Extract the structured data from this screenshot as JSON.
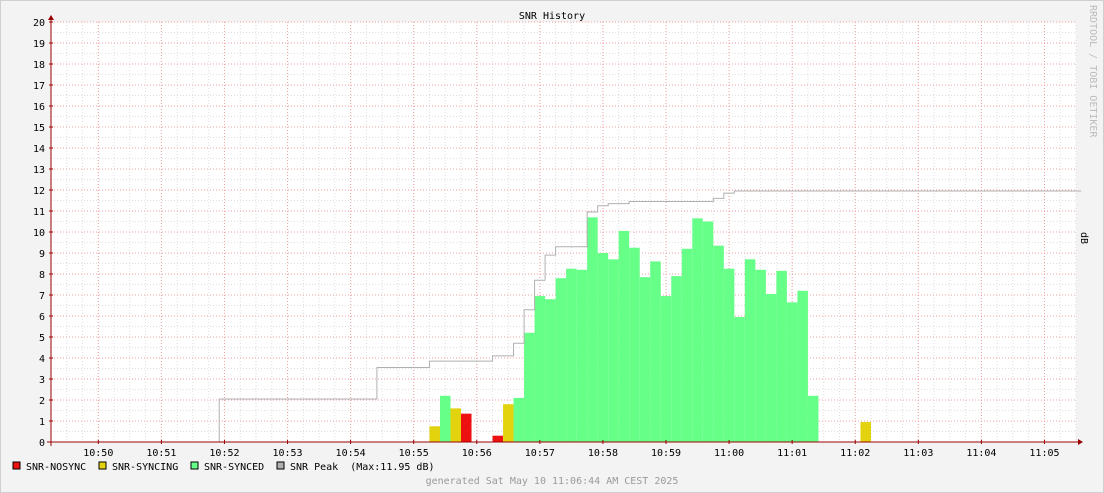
{
  "chart_data": {
    "type": "area",
    "title": "SNR History",
    "ylabel": "dB",
    "watermark": "RRDTOOL / TOBI OETIKER",
    "ylim": [
      0,
      20
    ],
    "y_ticks": [
      0,
      1,
      2,
      3,
      4,
      5,
      6,
      7,
      8,
      9,
      10,
      11,
      12,
      13,
      14,
      15,
      16,
      17,
      18,
      19,
      20
    ],
    "x_time_range": [
      "10:49:15",
      "11:05:30"
    ],
    "x_ticks": [
      "10:50",
      "10:51",
      "10:52",
      "10:53",
      "10:54",
      "10:55",
      "10:56",
      "10:57",
      "10:58",
      "10:59",
      "11:00",
      "11:01",
      "11:02",
      "11:03",
      "11:04",
      "11:05"
    ],
    "grid": true,
    "legend_position": "bottom-left",
    "colors": {
      "nosync": "#ee1111",
      "syncing": "#e3d20e",
      "synced": "#66ff88",
      "peak": "#b0b0b0",
      "grid_minor": "#dedede",
      "grid_major": "#f0a0a0",
      "axis": "#990000"
    },
    "interval_seconds": 10,
    "series": [
      {
        "name": "SNR-NOSYNC",
        "start": "10:49:15",
        "values": [
          0,
          0,
          0,
          0,
          0,
          0,
          0,
          0,
          0,
          0,
          0,
          0,
          0,
          0,
          0,
          0,
          0,
          0,
          0,
          0,
          0,
          0,
          0,
          0,
          0,
          0,
          0,
          0,
          0,
          0,
          0,
          0,
          0,
          0,
          0,
          0,
          0,
          0,
          0,
          1.35,
          0,
          0,
          0.3,
          0,
          0,
          0,
          0,
          0,
          0,
          0,
          0,
          0,
          0,
          0,
          0,
          0,
          0,
          0,
          0,
          0,
          0,
          0,
          0,
          0,
          0,
          0,
          0,
          0,
          0,
          0,
          0,
          0,
          0,
          0,
          0,
          0,
          0,
          0,
          0,
          0,
          0,
          0,
          0,
          0,
          0,
          0,
          0,
          0,
          0,
          0,
          0,
          0,
          0,
          0,
          0,
          0,
          0,
          0
        ]
      },
      {
        "name": "SNR-SYNCING",
        "start": "10:49:15",
        "values": [
          0,
          0,
          0,
          0,
          0,
          0,
          0,
          0,
          0,
          0,
          0,
          0,
          0,
          0,
          0,
          0,
          0,
          0,
          0,
          0,
          0,
          0,
          0,
          0,
          0,
          0,
          0,
          0,
          0,
          0,
          0,
          0,
          0,
          0,
          0,
          0,
          0.75,
          0,
          1.6,
          0,
          0,
          0,
          0,
          1.8,
          0,
          0,
          0,
          0,
          0,
          0,
          0,
          0,
          0,
          0,
          0,
          0,
          0,
          0,
          0,
          0,
          0,
          0,
          0,
          0,
          0,
          0,
          0,
          0,
          0,
          0,
          0,
          0,
          0,
          0,
          0,
          0,
          0,
          0.95,
          0,
          0,
          0,
          0,
          0,
          0,
          0,
          0,
          0,
          0,
          0,
          0,
          0,
          0,
          0,
          0,
          0,
          0,
          0,
          0,
          0,
          0
        ]
      },
      {
        "name": "SNR-SYNCED",
        "start": "10:49:15",
        "values": [
          0,
          0,
          0,
          0,
          0,
          0,
          0,
          0,
          0,
          0,
          0,
          0,
          0,
          0,
          0,
          0,
          0,
          0,
          0,
          0,
          0,
          0,
          0,
          0,
          0,
          0,
          0,
          0,
          0,
          0,
          0,
          0,
          0,
          0,
          0,
          0,
          0,
          2.2,
          0,
          0,
          0,
          0,
          0,
          0,
          2.1,
          5.2,
          6.95,
          6.8,
          7.8,
          8.25,
          8.2,
          10.7,
          9.0,
          8.7,
          10.05,
          9.25,
          7.85,
          8.6,
          6.95,
          7.9,
          9.2,
          10.65,
          10.5,
          9.35,
          8.25,
          5.95,
          8.7,
          8.2,
          7.05,
          8.15,
          6.65,
          7.2,
          2.2,
          0,
          0,
          0,
          0,
          0,
          0,
          0,
          0,
          0,
          0,
          0,
          0,
          0,
          0,
          0,
          0,
          0,
          0,
          0,
          0,
          0,
          0,
          0,
          0,
          0
        ]
      },
      {
        "name": "SNR Peak",
        "legend_suffix": "(Max:11.95 dB)",
        "type": "step",
        "start": "10:49:15",
        "values": [
          0,
          0,
          0,
          0,
          0,
          0,
          0,
          0,
          0,
          0,
          0,
          0,
          0,
          0,
          0,
          0,
          2.05,
          2.05,
          2.05,
          2.05,
          2.05,
          2.05,
          2.05,
          2.05,
          2.05,
          2.05,
          2.05,
          2.05,
          2.05,
          2.05,
          2.05,
          3.55,
          3.55,
          3.55,
          3.55,
          3.55,
          3.85,
          3.85,
          3.85,
          3.85,
          3.85,
          3.85,
          4.1,
          4.1,
          4.7,
          6.3,
          7.7,
          8.9,
          9.3,
          9.3,
          9.3,
          10.95,
          11.25,
          11.35,
          11.35,
          11.45,
          11.45,
          11.45,
          11.45,
          11.45,
          11.45,
          11.45,
          11.45,
          11.6,
          11.85,
          11.95,
          11.95,
          11.95,
          11.95,
          11.95,
          11.95,
          11.95,
          11.95,
          11.95,
          11.95,
          11.95,
          11.95,
          11.95,
          11.95,
          11.95,
          11.95,
          11.95,
          11.95,
          11.95,
          11.95,
          11.95,
          11.95,
          11.95,
          11.95,
          11.95,
          11.95,
          11.95,
          11.95,
          11.95,
          11.95,
          11.95,
          11.95,
          11.95
        ]
      }
    ],
    "legend": [
      {
        "key": "nosync",
        "label": "SNR-NOSYNC"
      },
      {
        "key": "syncing",
        "label": "SNR-SYNCING"
      },
      {
        "key": "synced",
        "label": "SNR-SYNCED"
      },
      {
        "key": "peak",
        "label": "SNR Peak  (Max:11.95 dB)"
      }
    ],
    "footer": "generated Sat May 10 11:06:44 AM CEST 2025"
  }
}
